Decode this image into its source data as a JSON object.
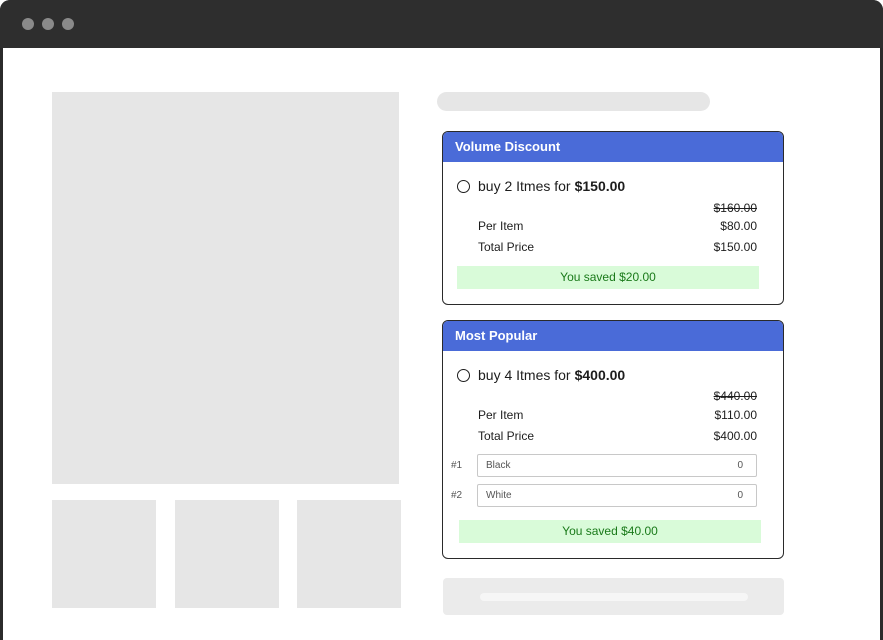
{
  "window": {
    "dots": [
      "close-dot",
      "minimize-dot",
      "maximize-dot"
    ]
  },
  "offers": [
    {
      "header": "Volume Discount",
      "buy_text": "buy 2 Itmes for",
      "buy_price": "$150.00",
      "original_price": "$160.00",
      "per_item_label": "Per Item",
      "per_item_value": "$80.00",
      "total_label": "Total Price",
      "total_value": "$150.00",
      "saved": "You saved $20.00"
    },
    {
      "header": "Most Popular",
      "buy_text": "buy 4 Itmes for",
      "buy_price": "$400.00",
      "original_price": "$440.00",
      "per_item_label": "Per Item",
      "per_item_value": "$110.00",
      "total_label": "Total Price",
      "total_value": "$400.00",
      "variants": [
        {
          "index": "#1",
          "name": "Black",
          "qty": "0"
        },
        {
          "index": "#2",
          "name": "White",
          "qty": "0"
        }
      ],
      "saved": "You saved $40.00"
    }
  ]
}
